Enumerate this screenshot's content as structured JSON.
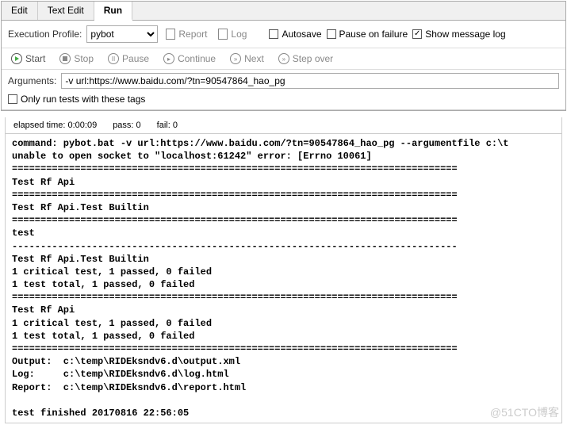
{
  "tabs": {
    "edit": "Edit",
    "text_edit": "Text Edit",
    "run": "Run"
  },
  "toolbar": {
    "exec_profile_label": "Execution Profile:",
    "exec_profile_value": "pybot",
    "report": "Report",
    "log": "Log",
    "autosave": "Autosave",
    "pause_on_failure": "Pause on failure",
    "show_message_log": "Show message log"
  },
  "runbar": {
    "start": "Start",
    "stop": "Stop",
    "pause": "Pause",
    "continue": "Continue",
    "next": "Next",
    "step_over": "Step over"
  },
  "args": {
    "label": "Arguments:",
    "value": "-v url:https://www.baidu.com/?tn=90547864_hao_pg"
  },
  "tags": {
    "label": "Only run tests with these tags"
  },
  "status": {
    "elapsed": "elapsed time: 0:00:09",
    "pass": "pass: 0",
    "fail": "fail: 0"
  },
  "console": "command: pybot.bat -v url:https://www.baidu.com/?tn=90547864_hao_pg --argumentfile c:\\t\nunable to open socket to \"localhost:61242\" error: [Errno 10061]\n==============================================================================\nTest Rf Api\n==============================================================================\nTest Rf Api.Test Builtin\n==============================================================================\ntest\n------------------------------------------------------------------------------\nTest Rf Api.Test Builtin\n1 critical test, 1 passed, 0 failed\n1 test total, 1 passed, 0 failed\n==============================================================================\nTest Rf Api\n1 critical test, 1 passed, 0 failed\n1 test total, 1 passed, 0 failed\n==============================================================================\nOutput:  c:\\temp\\RIDEksndv6.d\\output.xml\nLog:     c:\\temp\\RIDEksndv6.d\\log.html\nReport:  c:\\temp\\RIDEksndv6.d\\report.html\n\ntest finished 20170816 22:56:05",
  "watermark": "@51CTO博客"
}
